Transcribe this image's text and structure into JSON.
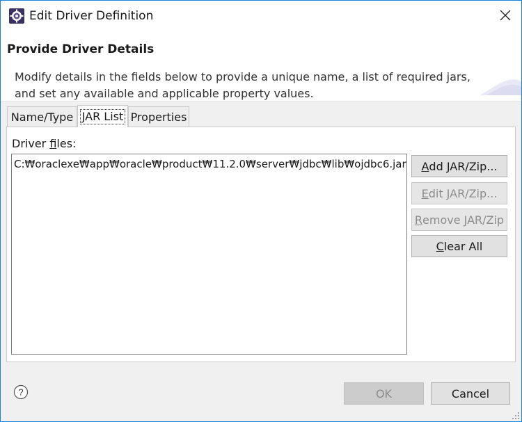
{
  "window": {
    "title": "Edit Driver Definition",
    "app_icon": "eclipse-gear-icon",
    "close_icon": "close-icon"
  },
  "header": {
    "title": "Provide Driver Details",
    "description": "Modify details in the fields below to provide a unique name, a list of required jars, and set any available and applicable property values."
  },
  "tabs": [
    {
      "label": "Name/Type",
      "active": false
    },
    {
      "label": "JAR List",
      "active": true
    },
    {
      "label": "Properties",
      "active": false
    }
  ],
  "jar_list": {
    "label_prefix": "Driver ",
    "label_mnemonic": "f",
    "label_suffix": "iles:",
    "files": [
      "C:₩oraclexe₩app₩oracle₩product₩11.2.0₩server₩jdbc₩lib₩ojdbc6.jar"
    ]
  },
  "buttons": {
    "add_mnemonic": "A",
    "add_rest": "dd JAR/Zip...",
    "edit_mnemonic": "E",
    "edit_rest": "dit JAR/Zip...",
    "remove_mnemonic": "R",
    "remove_rest": "emove JAR/Zip",
    "clear_mnemonic": "C",
    "clear_rest": "lear All",
    "ok": "OK",
    "cancel": "Cancel"
  },
  "help_icon": "help-icon",
  "colors": {
    "window_border": "#1683d8",
    "disabled_text": "#8c8c8c"
  }
}
